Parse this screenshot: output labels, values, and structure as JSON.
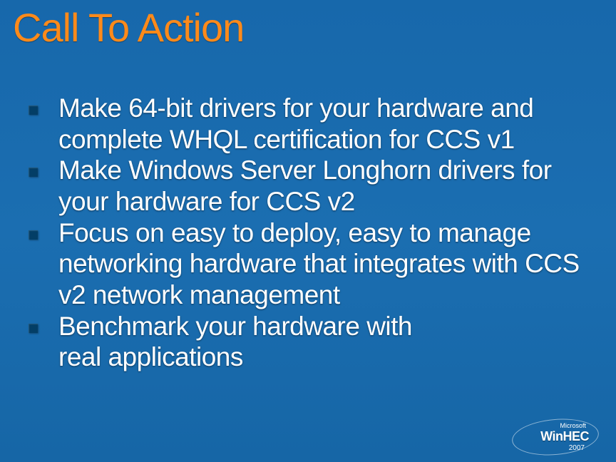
{
  "title": "Call To Action",
  "bullets": [
    "Make 64-bit drivers for your hardware and complete WHQL certification for CCS v1",
    "Make Windows Server Longhorn drivers for your hardware for CCS v2",
    "Focus on easy to deploy, easy to manage networking hardware that integrates with CCS v2 network management",
    "Benchmark your hardware with real applications"
  ],
  "logo": {
    "vendor": "Microsoft",
    "main": "WinHEC",
    "year": "2007"
  }
}
